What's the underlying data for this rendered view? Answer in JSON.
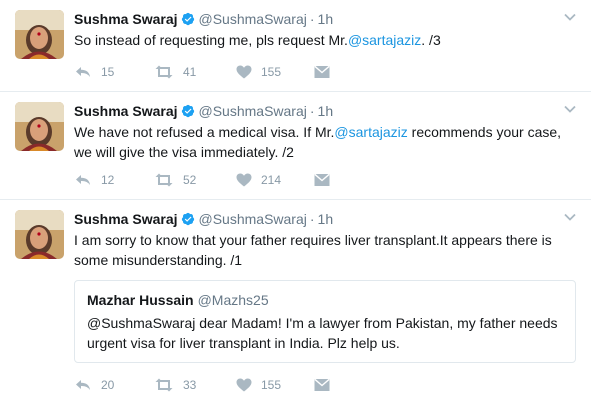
{
  "tweets": [
    {
      "name": "Sushma Swaraj",
      "handle": "@SushmaSwaraj",
      "separator": "·",
      "time": "1h",
      "text_before": "So instead of requesting me, pls request Mr.",
      "mention": "@sartajaziz",
      "text_after": ". /3",
      "replies": "15",
      "retweets": "41",
      "likes": "155"
    },
    {
      "name": "Sushma Swaraj",
      "handle": "@SushmaSwaraj",
      "separator": "·",
      "time": "1h",
      "text_before": "We have not refused a medical visa. If Mr.",
      "mention": "@sartajaziz",
      "text_after": " recommends your case, we will give the visa immediately. /2",
      "replies": "12",
      "retweets": "52",
      "likes": "214"
    },
    {
      "name": "Sushma Swaraj",
      "handle": "@SushmaSwaraj",
      "separator": "·",
      "time": "1h",
      "text": "I am sorry to know that your father requires liver transplant.It appears there is some misunderstanding. /1",
      "replies": "20",
      "retweets": "33",
      "likes": "155",
      "quote": {
        "name": "Mazhar Hussain",
        "handle": "@Mazhs25",
        "text": "@SushmaSwaraj dear Madam! I'm a lawyer from Pakistan, my father needs urgent visa for liver transplant in India. Plz help us."
      }
    }
  ],
  "icons": {
    "verified": "verified-badge-icon",
    "caret": "chevron-down-icon",
    "reply": "reply-icon",
    "retweet": "retweet-icon",
    "like": "heart-icon",
    "dm": "envelope-icon"
  },
  "colors": {
    "link": "#1b95e0",
    "verified": "#1da1f2",
    "muted": "#657786",
    "icon": "#aab8c2"
  }
}
